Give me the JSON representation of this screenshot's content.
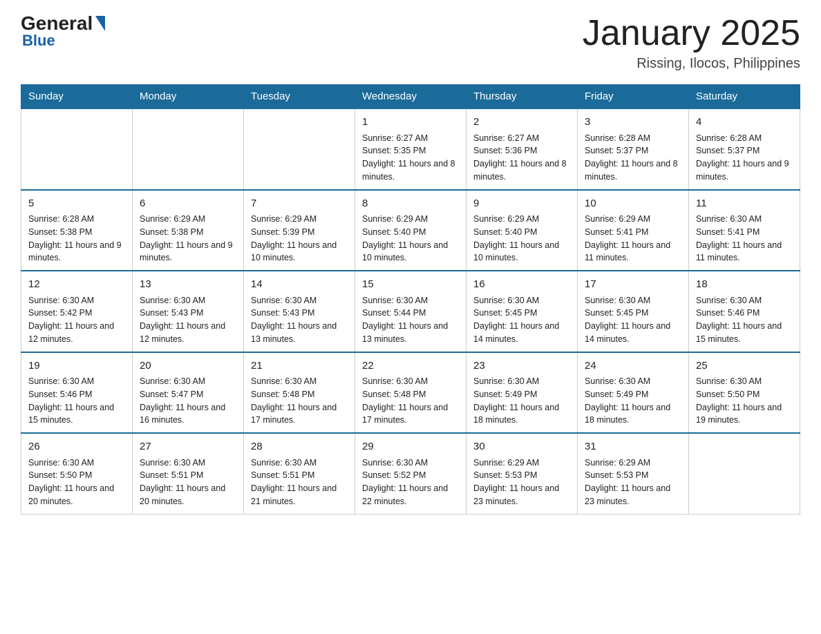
{
  "logo": {
    "part1": "General",
    "part2": "Blue"
  },
  "header": {
    "month": "January 2025",
    "location": "Rissing, Ilocos, Philippines"
  },
  "weekdays": [
    "Sunday",
    "Monday",
    "Tuesday",
    "Wednesday",
    "Thursday",
    "Friday",
    "Saturday"
  ],
  "weeks": [
    [
      {
        "day": "",
        "info": ""
      },
      {
        "day": "",
        "info": ""
      },
      {
        "day": "",
        "info": ""
      },
      {
        "day": "1",
        "info": "Sunrise: 6:27 AM\nSunset: 5:35 PM\nDaylight: 11 hours and 8 minutes."
      },
      {
        "day": "2",
        "info": "Sunrise: 6:27 AM\nSunset: 5:36 PM\nDaylight: 11 hours and 8 minutes."
      },
      {
        "day": "3",
        "info": "Sunrise: 6:28 AM\nSunset: 5:37 PM\nDaylight: 11 hours and 8 minutes."
      },
      {
        "day": "4",
        "info": "Sunrise: 6:28 AM\nSunset: 5:37 PM\nDaylight: 11 hours and 9 minutes."
      }
    ],
    [
      {
        "day": "5",
        "info": "Sunrise: 6:28 AM\nSunset: 5:38 PM\nDaylight: 11 hours and 9 minutes."
      },
      {
        "day": "6",
        "info": "Sunrise: 6:29 AM\nSunset: 5:38 PM\nDaylight: 11 hours and 9 minutes."
      },
      {
        "day": "7",
        "info": "Sunrise: 6:29 AM\nSunset: 5:39 PM\nDaylight: 11 hours and 10 minutes."
      },
      {
        "day": "8",
        "info": "Sunrise: 6:29 AM\nSunset: 5:40 PM\nDaylight: 11 hours and 10 minutes."
      },
      {
        "day": "9",
        "info": "Sunrise: 6:29 AM\nSunset: 5:40 PM\nDaylight: 11 hours and 10 minutes."
      },
      {
        "day": "10",
        "info": "Sunrise: 6:29 AM\nSunset: 5:41 PM\nDaylight: 11 hours and 11 minutes."
      },
      {
        "day": "11",
        "info": "Sunrise: 6:30 AM\nSunset: 5:41 PM\nDaylight: 11 hours and 11 minutes."
      }
    ],
    [
      {
        "day": "12",
        "info": "Sunrise: 6:30 AM\nSunset: 5:42 PM\nDaylight: 11 hours and 12 minutes."
      },
      {
        "day": "13",
        "info": "Sunrise: 6:30 AM\nSunset: 5:43 PM\nDaylight: 11 hours and 12 minutes."
      },
      {
        "day": "14",
        "info": "Sunrise: 6:30 AM\nSunset: 5:43 PM\nDaylight: 11 hours and 13 minutes."
      },
      {
        "day": "15",
        "info": "Sunrise: 6:30 AM\nSunset: 5:44 PM\nDaylight: 11 hours and 13 minutes."
      },
      {
        "day": "16",
        "info": "Sunrise: 6:30 AM\nSunset: 5:45 PM\nDaylight: 11 hours and 14 minutes."
      },
      {
        "day": "17",
        "info": "Sunrise: 6:30 AM\nSunset: 5:45 PM\nDaylight: 11 hours and 14 minutes."
      },
      {
        "day": "18",
        "info": "Sunrise: 6:30 AM\nSunset: 5:46 PM\nDaylight: 11 hours and 15 minutes."
      }
    ],
    [
      {
        "day": "19",
        "info": "Sunrise: 6:30 AM\nSunset: 5:46 PM\nDaylight: 11 hours and 15 minutes."
      },
      {
        "day": "20",
        "info": "Sunrise: 6:30 AM\nSunset: 5:47 PM\nDaylight: 11 hours and 16 minutes."
      },
      {
        "day": "21",
        "info": "Sunrise: 6:30 AM\nSunset: 5:48 PM\nDaylight: 11 hours and 17 minutes."
      },
      {
        "day": "22",
        "info": "Sunrise: 6:30 AM\nSunset: 5:48 PM\nDaylight: 11 hours and 17 minutes."
      },
      {
        "day": "23",
        "info": "Sunrise: 6:30 AM\nSunset: 5:49 PM\nDaylight: 11 hours and 18 minutes."
      },
      {
        "day": "24",
        "info": "Sunrise: 6:30 AM\nSunset: 5:49 PM\nDaylight: 11 hours and 18 minutes."
      },
      {
        "day": "25",
        "info": "Sunrise: 6:30 AM\nSunset: 5:50 PM\nDaylight: 11 hours and 19 minutes."
      }
    ],
    [
      {
        "day": "26",
        "info": "Sunrise: 6:30 AM\nSunset: 5:50 PM\nDaylight: 11 hours and 20 minutes."
      },
      {
        "day": "27",
        "info": "Sunrise: 6:30 AM\nSunset: 5:51 PM\nDaylight: 11 hours and 20 minutes."
      },
      {
        "day": "28",
        "info": "Sunrise: 6:30 AM\nSunset: 5:51 PM\nDaylight: 11 hours and 21 minutes."
      },
      {
        "day": "29",
        "info": "Sunrise: 6:30 AM\nSunset: 5:52 PM\nDaylight: 11 hours and 22 minutes."
      },
      {
        "day": "30",
        "info": "Sunrise: 6:29 AM\nSunset: 5:53 PM\nDaylight: 11 hours and 23 minutes."
      },
      {
        "day": "31",
        "info": "Sunrise: 6:29 AM\nSunset: 5:53 PM\nDaylight: 11 hours and 23 minutes."
      },
      {
        "day": "",
        "info": ""
      }
    ]
  ],
  "colors": {
    "header_bg": "#1a6b9a",
    "header_text": "#ffffff",
    "border": "#aabbcc"
  }
}
